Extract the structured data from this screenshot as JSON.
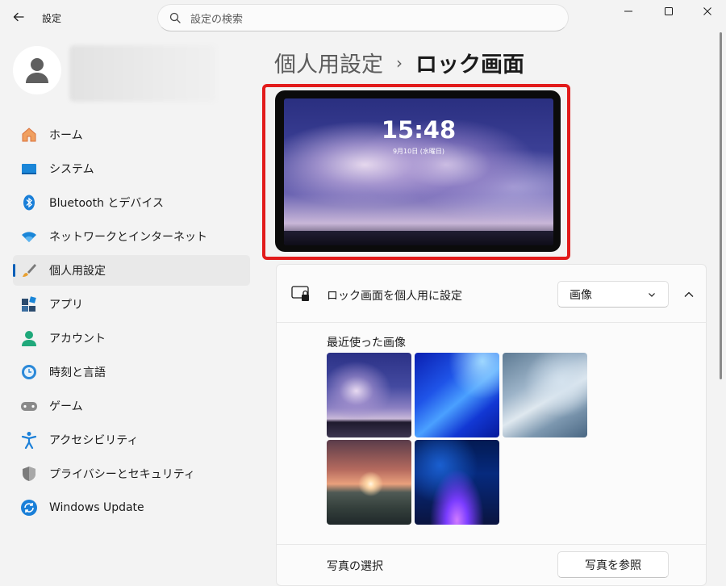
{
  "window": {
    "title": "設定",
    "controls": [
      "minimize-icon",
      "maximize-icon",
      "close-icon"
    ]
  },
  "search": {
    "placeholder": "設定の検索"
  },
  "nav": {
    "items": [
      {
        "label": "ホーム",
        "icon": "home-icon"
      },
      {
        "label": "システム",
        "icon": "system-icon"
      },
      {
        "label": "Bluetooth とデバイス",
        "icon": "bluetooth-icon"
      },
      {
        "label": "ネットワークとインターネット",
        "icon": "wifi-icon"
      },
      {
        "label": "個人用設定",
        "icon": "brush-icon",
        "selected": true
      },
      {
        "label": "アプリ",
        "icon": "apps-icon"
      },
      {
        "label": "アカウント",
        "icon": "account-icon"
      },
      {
        "label": "時刻と言語",
        "icon": "time-language-icon"
      },
      {
        "label": "ゲーム",
        "icon": "gamepad-icon"
      },
      {
        "label": "アクセシビリティ",
        "icon": "accessibility-icon"
      },
      {
        "label": "プライバシーとセキュリティ",
        "icon": "shield-icon"
      },
      {
        "label": "Windows Update",
        "icon": "update-icon"
      }
    ]
  },
  "header": {
    "parent": "個人用設定",
    "separator": "›",
    "current": "ロック画面"
  },
  "preview": {
    "time": "15:48",
    "date": "9月10日 (水曜日)"
  },
  "lock_screen": {
    "title": "ロック画面を個人用に設定",
    "dropdown_value": "画像",
    "recent_label": "最近使った画像",
    "photo_select_label": "写真の選択",
    "browse_button": "写真を参照"
  },
  "colors": {
    "accent": "#005fb8",
    "highlight": "#e21b1b"
  }
}
